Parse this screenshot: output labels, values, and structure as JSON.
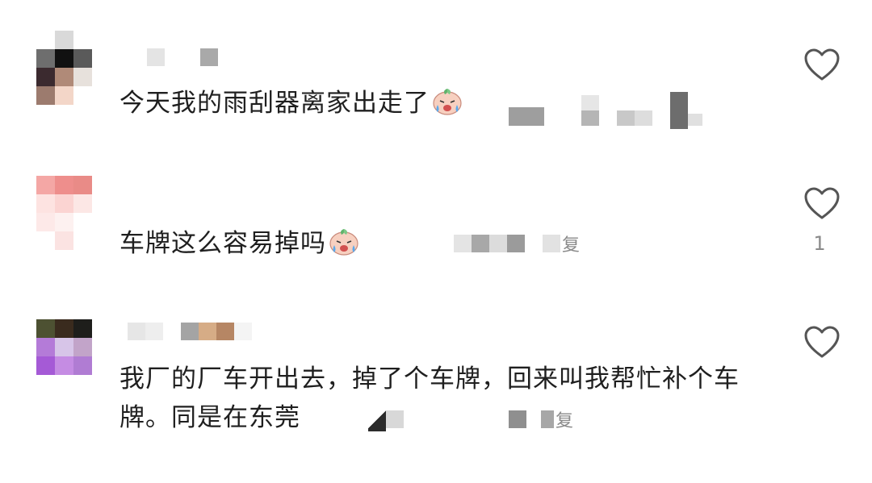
{
  "comments": [
    {
      "text": "今天我的雨刮器离家出走了",
      "emoji": "crying-baby-emoji",
      "reply_label": "",
      "like_count": "",
      "avatar_colors": [
        "#ffffff",
        "#d9d9d9",
        "#ffffff",
        "#6e6e6e",
        "#111111",
        "#5a5a5a",
        "#3b2a2f",
        "#b08a78",
        "#e7e1dc",
        "#9c7b6e",
        "#f3d6c8",
        "#ffffff"
      ]
    },
    {
      "text": "车牌这么容易掉吗",
      "emoji": "crying-baby-emoji",
      "reply_label": "复",
      "like_count": "1",
      "avatar_colors": [
        "#f4a7a5",
        "#ee8e8c",
        "#e98b87",
        "#fde3e1",
        "#fbd4d2",
        "#fce7e5",
        "#fde9e8",
        "#fdf1f0",
        "#ffffff",
        "#ffffff",
        "#fbe3e2",
        "#ffffff"
      ]
    },
    {
      "text": "我厂的厂车开出去，掉了个车牌，回来叫我帮忙补个车牌。同是在东莞",
      "emoji": "",
      "reply_label": "复",
      "like_count": "",
      "avatar_colors": [
        "#4d5132",
        "#3a2b1e",
        "#1e1e1b",
        "#b47bd8",
        "#d7c5e8",
        "#c2a4c9",
        "#a55ad6",
        "#c58ce3",
        "#b07cd3",
        "#ffffff",
        "#ffffff",
        "#ffffff"
      ]
    }
  ],
  "colors": {
    "text": "#1f1f1f",
    "muted": "#8a8a8a",
    "heart": "#555555"
  }
}
